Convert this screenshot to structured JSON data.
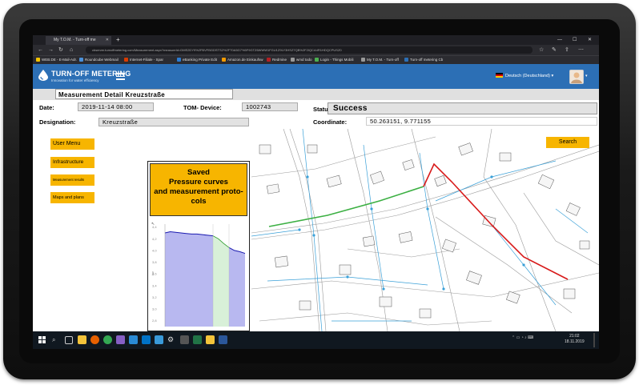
{
  "browser": {
    "tab_title": "My T.O.M. - Turn-off me",
    "url": "cbserver.turnoffmetering.com/Measurement.aspx?measureId=DMS2DY9%2FBVFBGDSTS2%2FT0A5G7%5F9GTZ6WWW1FGU1Z9LY3HSZ7QB%2F2IQCA4R1HDQCPUSZ0",
    "bookmarks": [
      {
        "label": "WEB.DE - E-Mail-Adr.",
        "color": "#f2c200"
      },
      {
        "label": "Roundcube Webmail",
        "color": "#4a90d9"
      },
      {
        "label": "Internet-Filiale - Spar",
        "color": "#d83b01"
      },
      {
        "label": "eBanking Private Edit",
        "color": "#2b7bd1"
      },
      {
        "label": "Amazon.de Einkaufsw",
        "color": "#f29b00"
      },
      {
        "label": "Redmine",
        "color": "#b32024"
      },
      {
        "label": "wmd todo",
        "color": "#999999"
      },
      {
        "label": "Login - Things Mobili",
        "color": "#4caf50"
      },
      {
        "label": "My T.O.M. - Turn-off",
        "color": "#999999"
      },
      {
        "label": "Turn-off metering Cb",
        "color": "#2c6fb5"
      }
    ]
  },
  "app": {
    "logo_title": "TURN-OFF METERING",
    "logo_subtitle": "Innovation for water efficiency",
    "language": "Deutsch (Deutschland)"
  },
  "detail": {
    "title": "Measurement Detail  Kreuzstraße",
    "date_label": "Date:",
    "date_value": "2019-11-14 08:00",
    "device_label": "TOM- Device:",
    "device_value": "1002743",
    "status_label": "Status:",
    "status_value": "Success",
    "designation_label": "Designation:",
    "designation_value": "Kreuzstraße",
    "coordinate_label": "Coordinate:",
    "coordinate_value": "50.263151, 9.771155"
  },
  "menu": {
    "user_menu": "User Menu",
    "infrastructure": "Infrastructure",
    "measurement_results": "Measurement results",
    "maps_plans": "Maps and plans",
    "search": "Search"
  },
  "saved_panel": {
    "line1": "Saved",
    "line2": "Pressure curves",
    "line3": "and measurement proto-",
    "line4": "cols"
  },
  "chart_data": {
    "type": "line",
    "ylabel": "bar",
    "yticks": [
      "4,4",
      "4,2",
      "4,0",
      "3,8",
      "3,6",
      "3,4",
      "3,2",
      "3,0",
      "2,8"
    ],
    "ylim": [
      2.7,
      4.45
    ],
    "series": [
      {
        "values": [
          4.3,
          4.32,
          4.31,
          4.3,
          4.29,
          4.28,
          4.28,
          4.27,
          4.26,
          4.25,
          4.2,
          4.12,
          4.05,
          4.0,
          3.98,
          3.95
        ]
      }
    ],
    "colors": {
      "line": "#1a1ab0",
      "fill": "#b8b8f0",
      "fill2": "#d8f0d8",
      "line2": "#2a9a2a"
    }
  },
  "taskbar": {
    "time": "21:02",
    "date": "18.11.2019",
    "icons": [
      {
        "name": "windows-start-icon",
        "color": "#ffffff"
      },
      {
        "name": "search-icon",
        "color": "#cccccc"
      },
      {
        "name": "task-view-icon",
        "color": "#cccccc"
      },
      {
        "name": "explorer-icon",
        "color": "#f3c33a"
      },
      {
        "name": "firefox-icon",
        "color": "#e66000"
      },
      {
        "name": "chrome-icon",
        "color": "#34a853"
      },
      {
        "name": "visual-studio-icon",
        "color": "#865fc5"
      },
      {
        "name": "edge-icon",
        "color": "#2a8ad4"
      },
      {
        "name": "outlook-icon",
        "color": "#0072c6"
      },
      {
        "name": "app-icon",
        "color": "#3a9ad9"
      },
      {
        "name": "settings-icon",
        "color": "#dddddd"
      },
      {
        "name": "git-icon",
        "color": "#cccccc"
      },
      {
        "name": "excel-icon",
        "color": "#217346"
      },
      {
        "name": "notes-icon",
        "color": "#f3c33a"
      },
      {
        "name": "word-icon",
        "color": "#2b579a"
      }
    ]
  }
}
